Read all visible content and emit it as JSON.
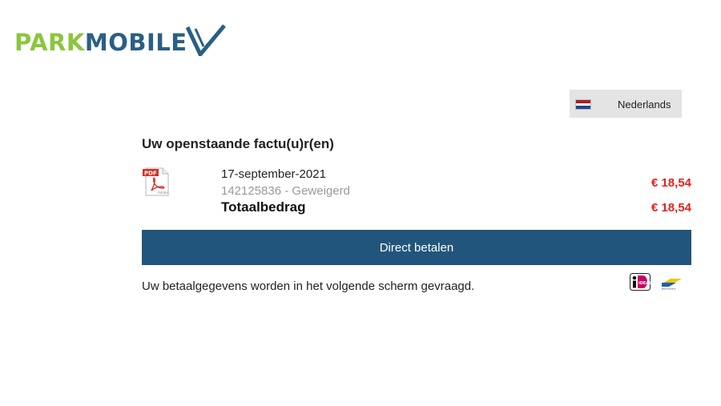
{
  "brand": {
    "park": "PARK",
    "mobile": "MOBILE"
  },
  "language": {
    "label": "Nederlands"
  },
  "invoices": {
    "heading": "Uw openstaande factu(u)r(en)",
    "items": [
      {
        "date": "17-september-2021",
        "status": "142125836 - Geweigerd",
        "amount": "€ 18,54"
      }
    ],
    "total_label": "Totaalbedrag",
    "total_amount": "€ 18,54"
  },
  "pay_button": {
    "label": "Direct betalen"
  },
  "footnote": "Uw betaalgegevens worden in het volgende scherm gevraagd.",
  "colors": {
    "brand_green": "#8cc63e",
    "brand_blue": "#2a5f86",
    "button": "#22557b",
    "amount_red": "#e3221c"
  },
  "icons": [
    "pdf-icon",
    "netherlands-flag-icon",
    "ideal-icon",
    "bancontact-icon"
  ]
}
